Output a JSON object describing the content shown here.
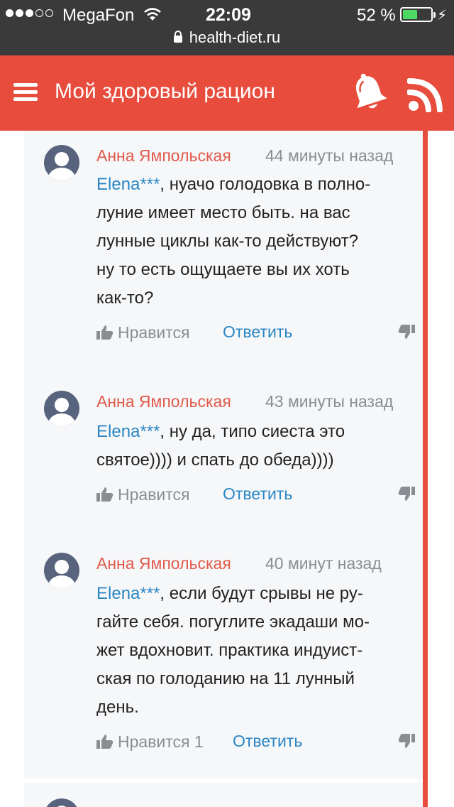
{
  "status_bar": {
    "carrier": "MegaFon",
    "time": "22:09",
    "battery_percent": "52 %",
    "battery_level": 0.52,
    "url": "health-diet.ru"
  },
  "header": {
    "title": "Мой здоровый рацион",
    "icons": [
      "menu-icon",
      "bell-icon",
      "rss-icon"
    ]
  },
  "colors": {
    "accent": "#e84c3d",
    "status_bar": "#3a3a3a",
    "link": "#2a86c4",
    "author": "#e05a4a"
  },
  "comments": [
    {
      "author": "Анна Ямпольская",
      "time": "44 минуты назад",
      "mention": "Elena***",
      "lines": [
        ", нуачо голодовка в полно-",
        "луние имеет место быть. на вас",
        "лунные циклы как-то действуют?",
        "ну то есть ощущаете вы их хоть",
        "как-то?"
      ],
      "like_label": "Нравится",
      "reply_label": "Ответить"
    },
    {
      "author": "Анна Ямпольская",
      "time": "43 минуты назад",
      "mention": "Elena***",
      "lines": [
        ", ну да, типо сиеста это",
        "святое)))) и спать до обеда))))"
      ],
      "like_label": "Нравится",
      "reply_label": "Ответить"
    },
    {
      "author": "Анна Ямпольская",
      "time": "40 минут назад",
      "mention": "Elena***",
      "lines": [
        ", если будут срывы не ру-",
        "гайте себя. погуглите экадаши мо-",
        "жет вдохновит. практика индуист-",
        "ская по голоданию на 11 лунный",
        "день."
      ],
      "like_label": "Нравится 1",
      "reply_label": "Ответить"
    }
  ]
}
